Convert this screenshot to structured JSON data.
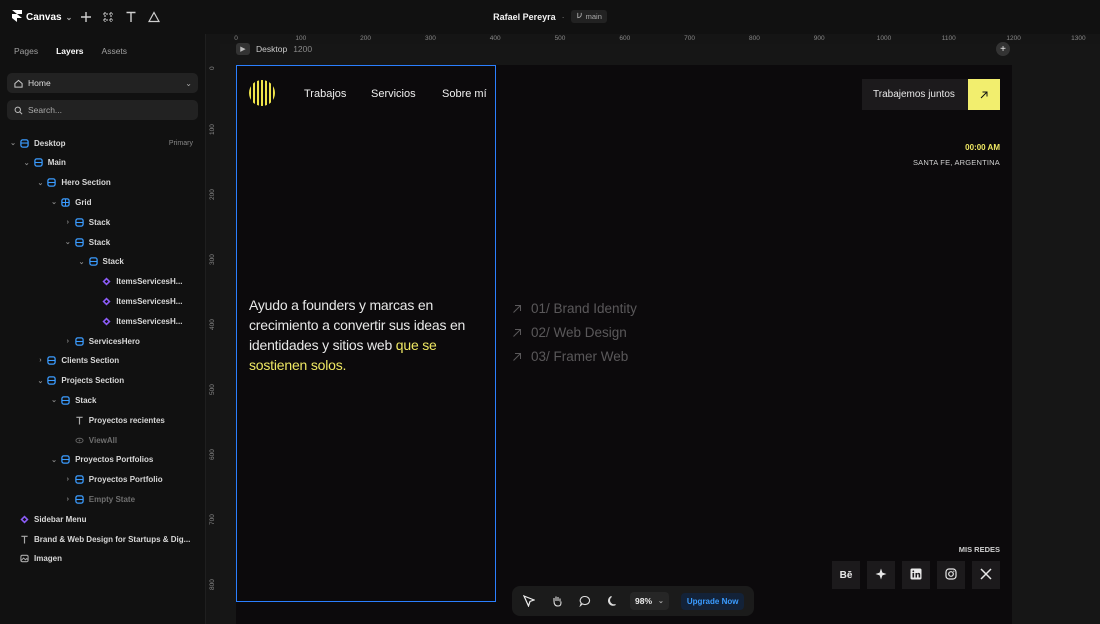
{
  "app": {
    "name": "Canvas",
    "project_title": "Rafael Pereyra",
    "title_separator": "·",
    "branch": "main"
  },
  "left_panel": {
    "tabs": [
      "Pages",
      "Layers",
      "Assets"
    ],
    "active_tab": "Layers",
    "page_selector": "Home",
    "search_placeholder": "Search...",
    "layers": [
      {
        "label": "Desktop",
        "badge": "Primary",
        "icon": "frame-icon"
      },
      {
        "label": "Main",
        "icon": "stack-icon"
      },
      {
        "label": "Hero Section",
        "icon": "stack-icon"
      },
      {
        "label": "Grid",
        "icon": "grid-icon"
      },
      {
        "label": "Stack",
        "icon": "stack-icon"
      },
      {
        "label": "Stack",
        "icon": "stack-icon"
      },
      {
        "label": "Stack",
        "icon": "stack-icon"
      },
      {
        "label": "ItemsServicesH...",
        "icon": "component-icon"
      },
      {
        "label": "ItemsServicesH...",
        "icon": "component-icon"
      },
      {
        "label": "ItemsServicesH...",
        "icon": "component-icon"
      },
      {
        "label": "ServicesHero",
        "icon": "stack-icon"
      },
      {
        "label": "Clients Section",
        "icon": "stack-icon"
      },
      {
        "label": "Projects Section",
        "icon": "stack-icon"
      },
      {
        "label": "Stack",
        "icon": "stack-icon"
      },
      {
        "label": "Proyectos recientes",
        "icon": "text-icon"
      },
      {
        "label": "ViewAll",
        "icon": "hidden-icon"
      },
      {
        "label": "Proyectos Portfolios",
        "icon": "stack-icon"
      },
      {
        "label": "Proyectos Portfolio",
        "icon": "stack-icon"
      },
      {
        "label": "Empty State",
        "icon": "stack-icon"
      },
      {
        "label": "Sidebar Menu",
        "icon": "component-icon"
      },
      {
        "label": "Brand & Web Design for Startups & Dig...",
        "icon": "text-icon"
      },
      {
        "label": "Imagen",
        "icon": "image-icon"
      }
    ]
  },
  "canvas": {
    "ruler_top": [
      "0",
      "100",
      "200",
      "300",
      "400",
      "500",
      "600",
      "700",
      "800",
      "900",
      "1000",
      "1100",
      "1200",
      "1300"
    ],
    "ruler_left": [
      "0",
      "100",
      "200",
      "300",
      "400",
      "500",
      "600",
      "700",
      "800"
    ],
    "frame_name": "Desktop",
    "frame_size": "1200"
  },
  "site": {
    "nav": [
      "Trabajos",
      "Servicios",
      "Sobre mí"
    ],
    "hero_text": "Ayudo a founders y marcas en crecimiento a convertir sus ideas en identidades y sitios web ",
    "hero_highlight": "que se sostienen solos.",
    "cta_label": "Trabajemos juntos",
    "time": "00:00 AM",
    "location": "SANTA FE, ARGENTINA",
    "services": [
      "01/ Brand Identity",
      "02/ Web Design",
      "03/ Framer Web"
    ],
    "social_heading": "MIS REDES",
    "social": [
      "Bē",
      "framer-icon",
      "linkedin-icon",
      "instagram-icon",
      "x-icon"
    ],
    "behance_label": "Bē",
    "accent": "#efe863"
  },
  "toolbar": {
    "zoom": "98%",
    "upgrade": "Upgrade Now"
  }
}
